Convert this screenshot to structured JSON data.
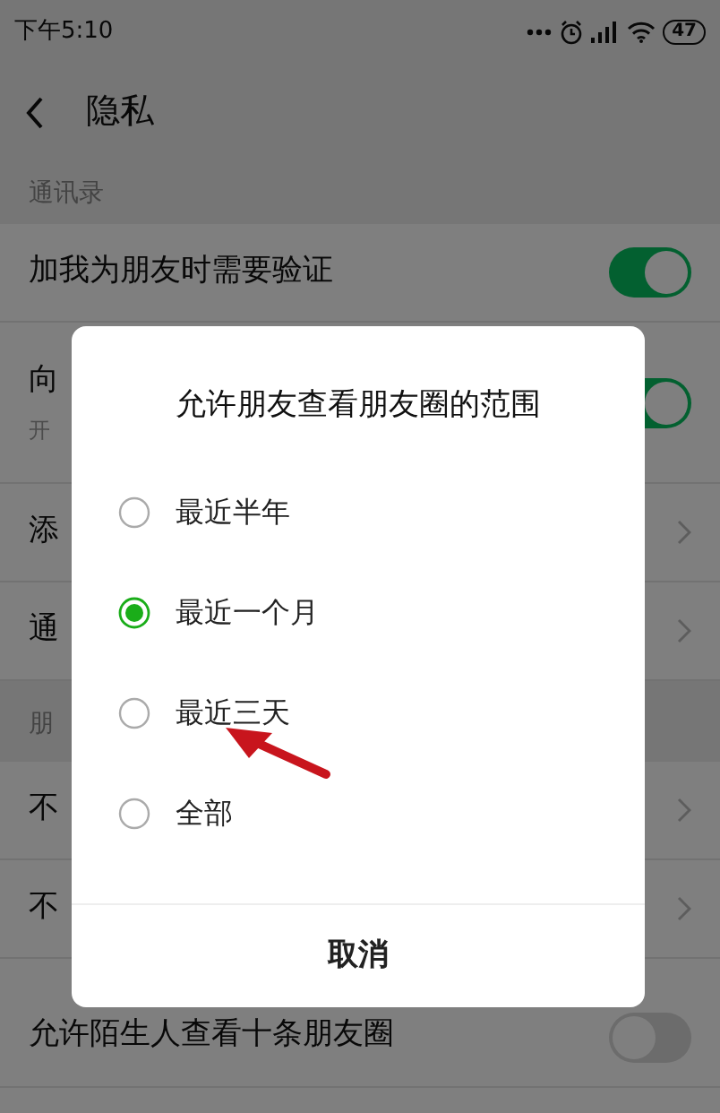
{
  "status_bar": {
    "time": "下午5:10",
    "battery": "47"
  },
  "header": {
    "title": "隐私"
  },
  "sections": [
    {
      "label": "通讯录",
      "rows": [
        {
          "kind": "toggle",
          "label": "加我为朋友时需要验证",
          "on": true
        },
        {
          "kind": "toggle",
          "label": "向",
          "subtitle": "开",
          "on": true
        },
        {
          "kind": "link",
          "label": "添"
        },
        {
          "kind": "link",
          "label": "通"
        }
      ]
    },
    {
      "label": "朋",
      "rows": [
        {
          "kind": "link",
          "label": "不"
        },
        {
          "kind": "link",
          "label": "不"
        },
        {
          "kind": "toggle",
          "label": "允许陌生人查看十条朋友圈",
          "on": false
        }
      ]
    }
  ],
  "dialog": {
    "title": "允许朋友查看朋友圈的范围",
    "options": [
      {
        "label": "最近半年",
        "selected": false
      },
      {
        "label": "最近一个月",
        "selected": true
      },
      {
        "label": "最近三天",
        "selected": false
      },
      {
        "label": "全部",
        "selected": false
      }
    ],
    "cancel": "取消"
  }
}
